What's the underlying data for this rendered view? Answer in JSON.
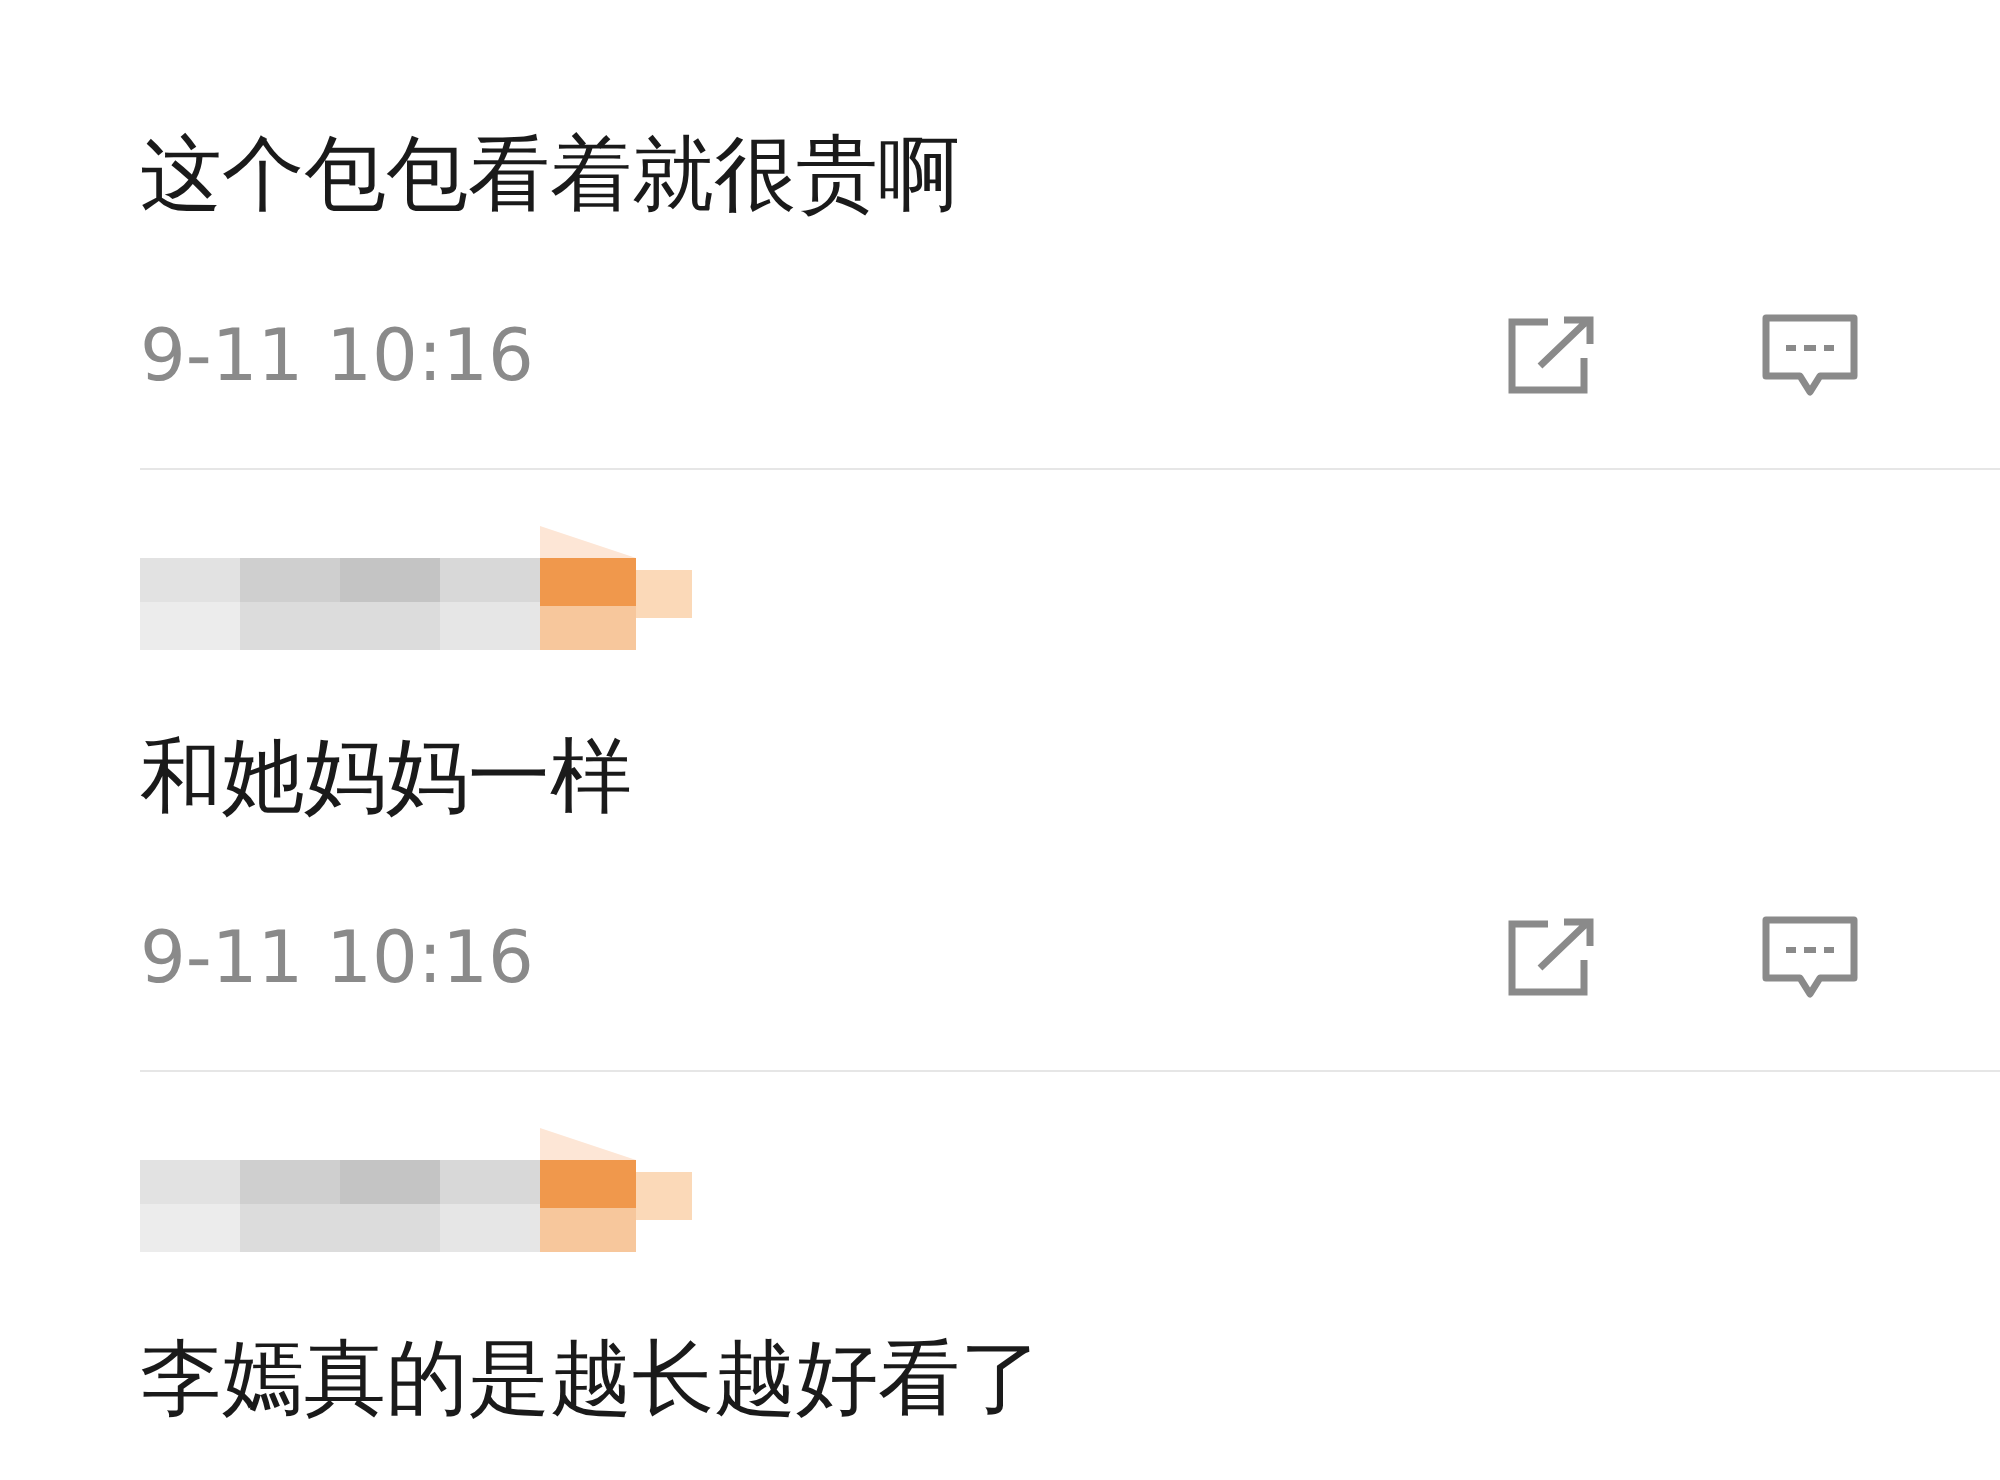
{
  "comments": [
    {
      "author_pixelated": false,
      "text": "这个包包看着就很贵啊",
      "time": "9-11 10:16"
    },
    {
      "author_pixelated": true,
      "text": "和她妈妈一样",
      "time": "9-11 10:16"
    },
    {
      "author_pixelated": true,
      "text": "李嫣真的是越长越好看了"
    }
  ]
}
